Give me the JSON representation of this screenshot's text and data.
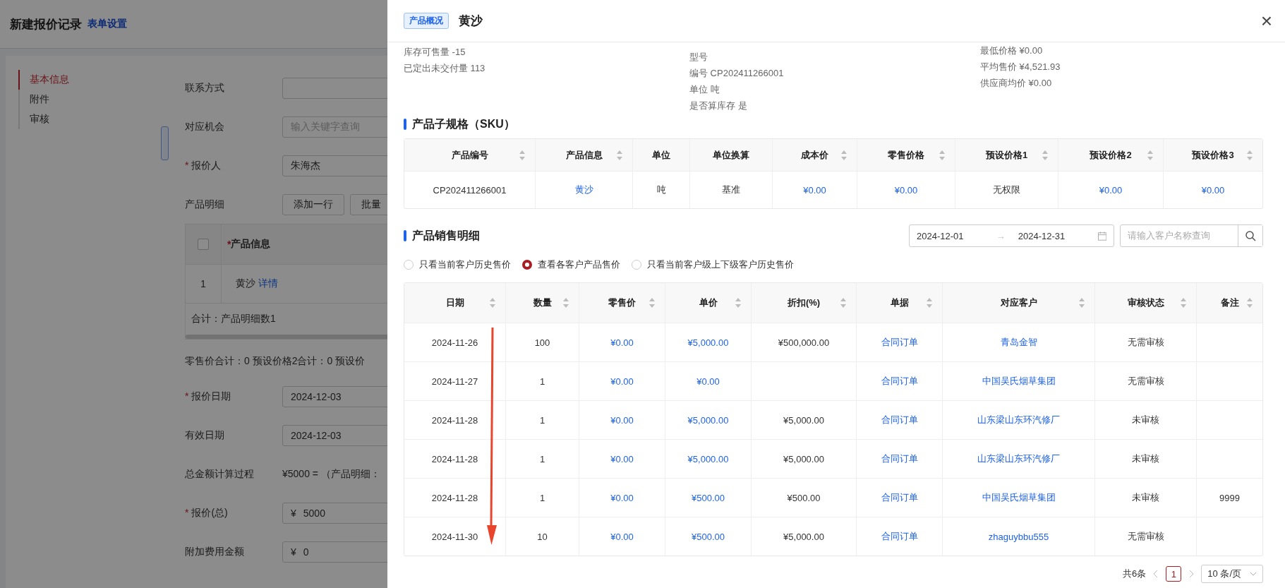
{
  "page": {
    "title": "新建报价记录",
    "settings_link": "表单设置",
    "required_mark": "*"
  },
  "nav": [
    {
      "label": "基本信息",
      "selected": true
    },
    {
      "label": "附件",
      "selected": false
    },
    {
      "label": "审核",
      "selected": false
    }
  ],
  "form": [
    {
      "kind": "input",
      "label": "联系方式",
      "required": false
    },
    {
      "kind": "input",
      "label": "对应机会",
      "required": false,
      "placeholder": "输入关键字查询"
    },
    {
      "kind": "input",
      "label": "报价人",
      "required": true,
      "value": "朱海杰"
    },
    {
      "kind": "buttons",
      "label": "产品明细",
      "buttons": [
        "添加一行",
        "批量"
      ]
    },
    {
      "kind": "table",
      "checked": false,
      "column": {
        "label": "产品信息",
        "required": true
      },
      "rows": [
        {
          "index": "1",
          "product": "黄沙",
          "link": "详情"
        }
      ],
      "total": "合计：产品明细数1"
    },
    {
      "kind": "note",
      "text": "零售价合计：0  预设价格2合计：0  预设价"
    },
    {
      "kind": "input",
      "label": "报价日期",
      "required": true,
      "value": "2024-12-03"
    },
    {
      "kind": "input",
      "label": "有效日期",
      "required": false,
      "value": "2024-12-03"
    },
    {
      "kind": "text",
      "label": "总金额计算过程",
      "value": "¥5000 = （产品明细："
    },
    {
      "kind": "input",
      "label": "报价(总)",
      "required": true,
      "prefix": "¥",
      "value": "5000"
    },
    {
      "kind": "input",
      "label": "附加费用金额",
      "required": false,
      "prefix": "¥",
      "value": "0"
    }
  ],
  "drawer": {
    "tag": "产品概况",
    "title": "黄沙",
    "close": "×",
    "info_columns": [
      [
        "库存可售量  -15",
        "已定出未交付量  113"
      ],
      [
        "型号",
        "编号 CP202411266001",
        "单位 吨",
        "是否算库存 是"
      ],
      [
        "最低价格 ¥0.00",
        "平均售价 ¥4,521.93",
        "供应商均价 ¥0.00"
      ]
    ],
    "sku": {
      "title": "产品子规格（SKU）",
      "columns": [
        {
          "label": "产品编号",
          "sortable": true
        },
        {
          "label": "产品信息",
          "sortable": true
        },
        {
          "label": "单位",
          "sortable": false
        },
        {
          "label": "单位换算",
          "sortable": false
        },
        {
          "label": "成本价",
          "sortable": true
        },
        {
          "label": "零售价格",
          "sortable": true
        },
        {
          "label": "预设价格1",
          "sortable": true
        },
        {
          "label": "预设价格2",
          "sortable": true
        },
        {
          "label": "预设价格3",
          "sortable": true
        }
      ],
      "rows": [
        [
          {
            "text": "CP202411266001",
            "link": false
          },
          {
            "text": "黄沙",
            "link": true
          },
          {
            "text": "吨",
            "link": false
          },
          {
            "text": "基准",
            "link": false
          },
          {
            "text": "¥0.00",
            "link": true
          },
          {
            "text": "¥0.00",
            "link": true
          },
          {
            "text": "无权限",
            "link": false
          },
          {
            "text": "¥0.00",
            "link": true
          },
          {
            "text": "¥0.00",
            "link": true
          }
        ]
      ]
    },
    "sales": {
      "title": "产品销售明细",
      "date_start": "2024-12-01",
      "date_separator": "→",
      "date_end": "2024-12-31",
      "search_placeholder": "请输入客户名称查询",
      "filters": [
        {
          "label": "只看当前客户历史售价",
          "selected": false
        },
        {
          "label": "查看各客户产品售价",
          "selected": true
        },
        {
          "label": "只看当前客户级上下级客户历史售价",
          "selected": false
        }
      ],
      "columns": [
        {
          "label": "日期",
          "sortable": true
        },
        {
          "label": "数量",
          "sortable": true
        },
        {
          "label": "零售价",
          "sortable": true
        },
        {
          "label": "单价",
          "sortable": true
        },
        {
          "label": "折扣(%)",
          "sortable": true
        },
        {
          "label": "单据",
          "sortable": true
        },
        {
          "label": "对应客户",
          "sortable": true
        },
        {
          "label": "审核状态",
          "sortable": true
        },
        {
          "label": "备注",
          "sortable": true
        }
      ],
      "rows": [
        [
          {
            "text": "2024-11-26",
            "link": false
          },
          {
            "text": "100",
            "link": false
          },
          {
            "text": "¥0.00",
            "link": true
          },
          {
            "text": "¥5,000.00",
            "link": true
          },
          {
            "text": "¥500,000.00",
            "link": false
          },
          {
            "text": "合同订单",
            "link": true
          },
          {
            "text": "青岛金智",
            "link": true
          },
          {
            "text": "无需审核",
            "link": false
          },
          null
        ],
        [
          {
            "text": "2024-11-27",
            "link": false
          },
          {
            "text": "1",
            "link": false
          },
          {
            "text": "¥0.00",
            "link": true
          },
          {
            "text": "¥0.00",
            "link": true
          },
          null,
          {
            "text": "合同订单",
            "link": true
          },
          {
            "text": "中国吴氏烟草集团",
            "link": true
          },
          {
            "text": "无需审核",
            "link": false
          },
          null
        ],
        [
          {
            "text": "2024-11-28",
            "link": false
          },
          {
            "text": "1",
            "link": false
          },
          {
            "text": "¥0.00",
            "link": true
          },
          {
            "text": "¥5,000.00",
            "link": true
          },
          {
            "text": "¥5,000.00",
            "link": false
          },
          {
            "text": "合同订单",
            "link": true
          },
          {
            "text": "山东梁山东环汽修厂",
            "link": true
          },
          {
            "text": "未审核",
            "link": false
          },
          null
        ],
        [
          {
            "text": "2024-11-28",
            "link": false
          },
          {
            "text": "1",
            "link": false
          },
          {
            "text": "¥0.00",
            "link": true
          },
          {
            "text": "¥5,000.00",
            "link": true
          },
          {
            "text": "¥5,000.00",
            "link": false
          },
          {
            "text": "合同订单",
            "link": true
          },
          {
            "text": "山东梁山东环汽修厂",
            "link": true
          },
          {
            "text": "未审核",
            "link": false
          },
          null
        ],
        [
          {
            "text": "2024-11-28",
            "link": false
          },
          {
            "text": "1",
            "link": false
          },
          {
            "text": "¥0.00",
            "link": true
          },
          {
            "text": "¥500.00",
            "link": true
          },
          {
            "text": "¥500.00",
            "link": false
          },
          {
            "text": "合同订单",
            "link": true
          },
          {
            "text": "中国吴氏烟草集团",
            "link": true
          },
          {
            "text": "未审核",
            "link": false
          },
          {
            "text": "9999",
            "link": false
          }
        ],
        [
          {
            "text": "2024-11-30",
            "link": false
          },
          {
            "text": "10",
            "link": false
          },
          {
            "text": "¥0.00",
            "link": true
          },
          {
            "text": "¥500.00",
            "link": true
          },
          {
            "text": "¥5,000.00",
            "link": false
          },
          {
            "text": "合同订单",
            "link": true
          },
          {
            "text": "zhaguybbu555",
            "link": true
          },
          {
            "text": "无需审核",
            "link": false
          },
          null
        ]
      ],
      "pagination": {
        "total": "共6条",
        "pages": [
          {
            "label": "1",
            "selected": true
          }
        ],
        "page_size": "10 条/页"
      }
    }
  }
}
